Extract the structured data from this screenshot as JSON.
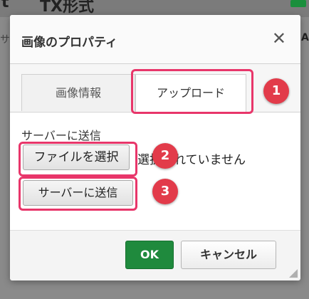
{
  "background": {
    "left_text": "t",
    "right_text": "TX形式",
    "side_left_text": "サ",
    "side_right_text": "A"
  },
  "dialog": {
    "title": "画像のプロパティ",
    "close_glyph": "✕"
  },
  "tabs": [
    {
      "label": "画像情報",
      "active": false
    },
    {
      "label": "アップロード",
      "active": true
    }
  ],
  "upload": {
    "section_label": "サーバーに送信",
    "choose_file_label": "ファイルを選択",
    "no_file_text": "選択されていません",
    "send_label": "サーバーに送信"
  },
  "footer": {
    "ok_label": "OK",
    "cancel_label": "キャンセル"
  },
  "annotations": [
    {
      "number": "1"
    },
    {
      "number": "2"
    },
    {
      "number": "3"
    }
  ],
  "colors": {
    "ok_green": "#1f8a3d",
    "highlight_pink": "#e8366a",
    "badge_red": "#e23b4a"
  }
}
